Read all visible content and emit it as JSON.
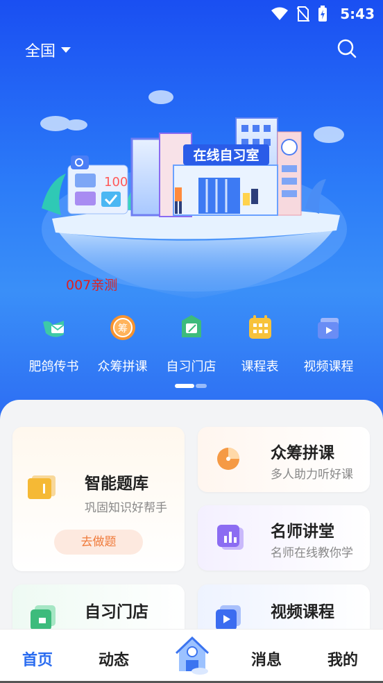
{
  "status_bar": {
    "time": "5:43",
    "icons": [
      "wifi-icon",
      "no-sim-icon",
      "battery-charging-icon"
    ]
  },
  "header": {
    "city": "全国",
    "dropdown_icon": "caret-down-icon",
    "search_icon": "search-icon"
  },
  "banner": {
    "sign_text": "在线自习室",
    "board_text": "100",
    "watermark": "007亲测"
  },
  "quick_nav": [
    {
      "label": "肥鸽传书",
      "icon": "pigeon-mail-icon",
      "color": "#3ec9a7"
    },
    {
      "label": "众筹拼课",
      "icon": "crowdfund-coin-icon",
      "color": "#f7932f",
      "glyph": "筹"
    },
    {
      "label": "自习门店",
      "icon": "study-store-icon",
      "color": "#3dbb7c"
    },
    {
      "label": "课程表",
      "icon": "calendar-icon",
      "color": "#f7c23b"
    },
    {
      "label": "视频课程",
      "icon": "video-course-icon",
      "color": "#6a8df5"
    }
  ],
  "cards": {
    "question_bank": {
      "title": "智能题库",
      "subtitle": "巩固知识好帮手",
      "button": "去做题"
    },
    "crowdfund": {
      "title": "众筹拼课",
      "subtitle": "多人助力听好课"
    },
    "famous_teacher": {
      "title": "名师讲堂",
      "subtitle": "名师在线教你学"
    },
    "study_store": {
      "title": "自习门店"
    },
    "video_course": {
      "title": "视频课程"
    }
  },
  "tabbar": {
    "home": "首页",
    "feed": "动态",
    "center_icon": "study-room-house-icon",
    "messages": "消息",
    "mine": "我的",
    "active": "首页",
    "accent": "#2a6cf0"
  }
}
